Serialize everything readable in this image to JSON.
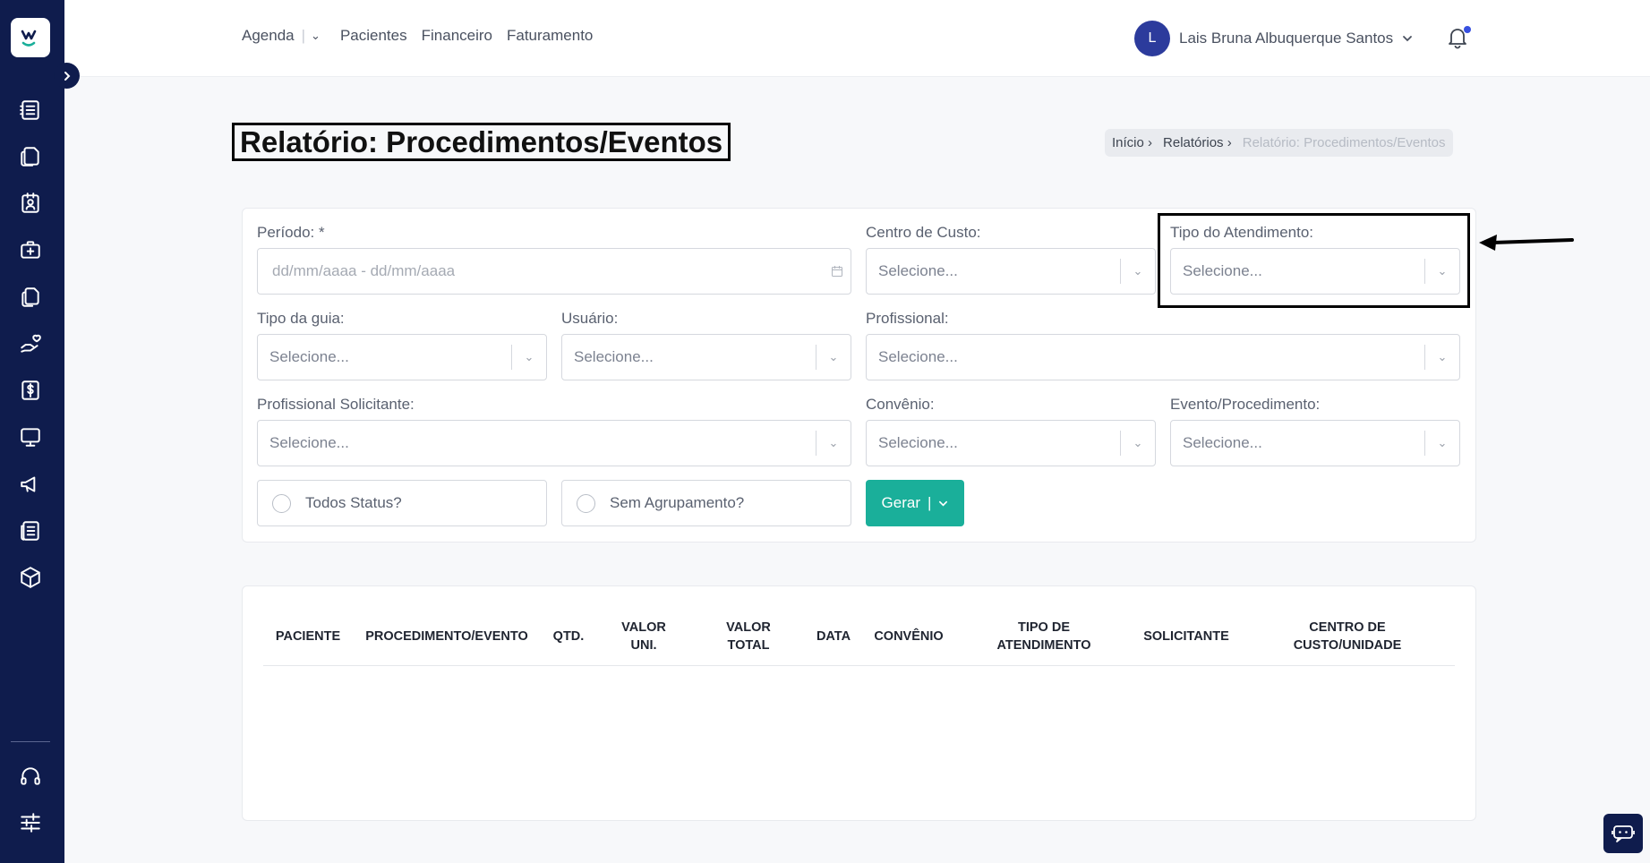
{
  "topnav": {
    "agenda": "Agenda",
    "pacientes": "Pacientes",
    "financeiro": "Financeiro",
    "faturamento": "Faturamento"
  },
  "user": {
    "initial": "L",
    "name": "Lais Bruna Albuquerque Santos"
  },
  "page": {
    "title": "Relatório: Procedimentos/Eventos"
  },
  "breadcrumb": {
    "home": "Início",
    "reports": "Relatórios",
    "current": "Relatório: Procedimentos/Eventos"
  },
  "filters": {
    "periodo_label": "Período: *",
    "periodo_placeholder": "dd/mm/aaaa - dd/mm/aaaa",
    "centro_custo_label": "Centro de Custo:",
    "tipo_atendimento_label": "Tipo do Atendimento:",
    "tipo_guia_label": "Tipo da guia:",
    "usuario_label": "Usuário:",
    "profissional_label": "Profissional:",
    "prof_solicitante_label": "Profissional Solicitante:",
    "convenio_label": "Convênio:",
    "evento_label": "Evento/Procedimento:",
    "select_placeholder": "Selecione...",
    "todos_status": "Todos Status?",
    "sem_agrupamento": "Sem Agrupamento?",
    "gerar": "Gerar"
  },
  "table": {
    "columns": [
      "PACIENTE",
      "PROCEDIMENTO/EVENTO",
      "QTD.",
      "VALOR UNI.",
      "VALOR TOTAL",
      "DATA",
      "CONVÊNIO",
      "TIPO DE ATENDIMENTO",
      "SOLICITANTE",
      "CENTRO DE CUSTO/UNIDADE"
    ]
  },
  "colors": {
    "sidebar": "#0f1c4d",
    "accent": "#1aaf9a",
    "avatar": "#2c3b9c"
  },
  "icons": {
    "sidebar": [
      "notebook-icon",
      "documents-icon",
      "id-badge-icon",
      "medical-bag-icon",
      "file-copy-icon",
      "hand-heart-icon",
      "invoice-dollar-icon",
      "monitor-icon",
      "megaphone-icon",
      "newspaper-icon",
      "cube-icon",
      "headset-icon",
      "sliders-icon"
    ]
  }
}
